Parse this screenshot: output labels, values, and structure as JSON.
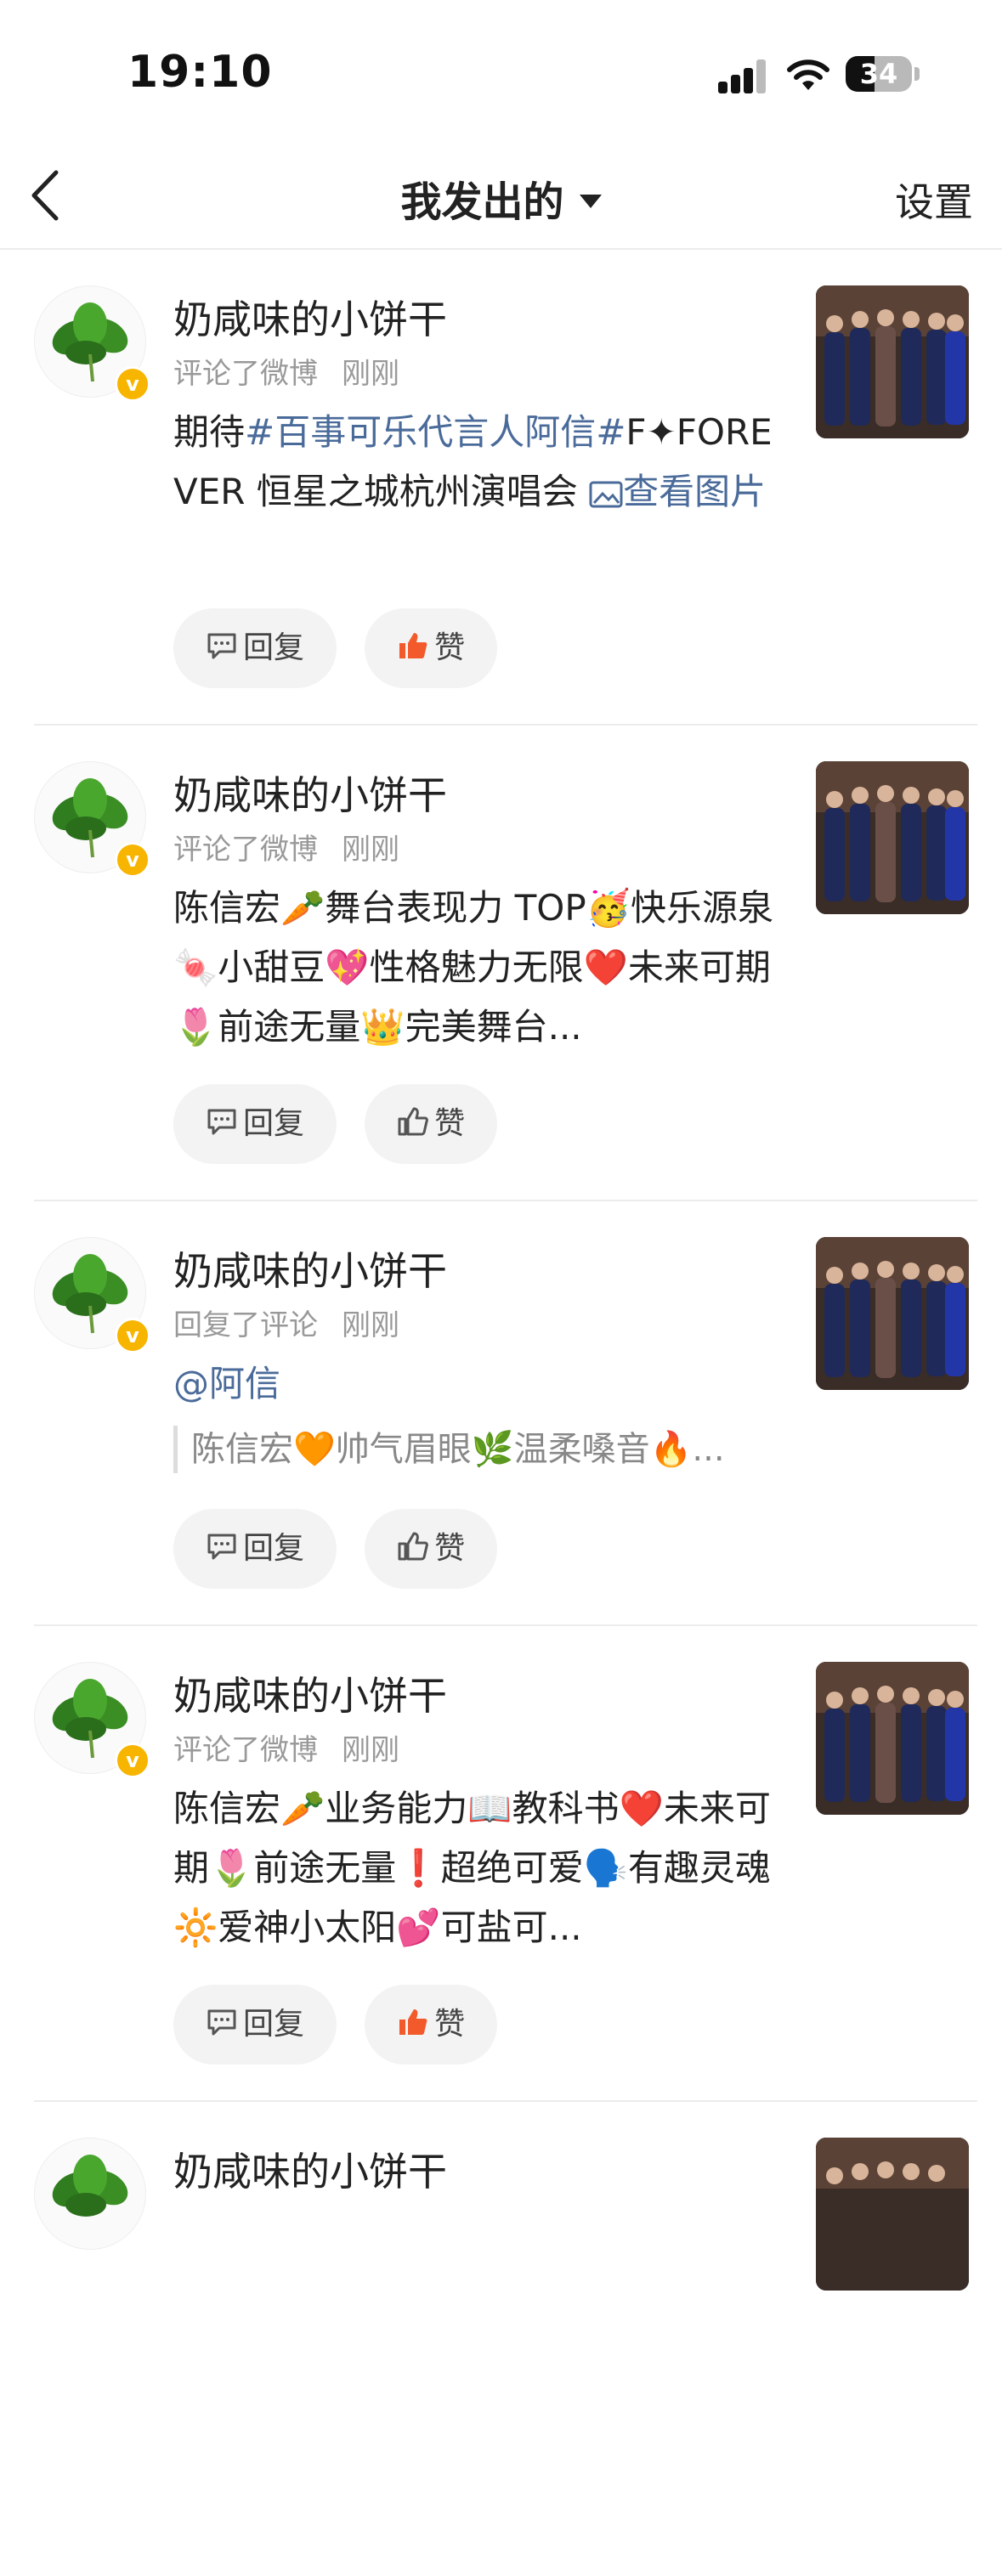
{
  "status_bar": {
    "time": "19:10",
    "battery": "34"
  },
  "nav": {
    "title": "我发出的",
    "settings": "设置"
  },
  "colors": {
    "accent_link": "#4a6b9a",
    "like_active": "#f25a2c",
    "badge": "#f7b500"
  },
  "items": [
    {
      "name": "奶咸味的小饼干",
      "action": "评论了微博",
      "time": "刚刚",
      "content_prefix": "期待",
      "hashtag": "#百事可乐代言人阿信#",
      "content_rest": "F✦FOREVER 恒星之城杭州演唱会 ",
      "view_pic": "查看图片",
      "reply": "回复",
      "like": "赞",
      "liked": true
    },
    {
      "name": "奶咸味的小饼干",
      "action": "评论了微博",
      "time": "刚刚",
      "content": "陈信宏🥕舞台表现力 TOP🥳快乐源泉🍬小甜豆💖性格魅力无限❤️未来可期🌷前途无量👑完美舞台...",
      "reply": "回复",
      "like": "赞",
      "liked": false
    },
    {
      "name": "奶咸味的小饼干",
      "action": "回复了评论",
      "time": "刚刚",
      "mention": "@阿信",
      "quote": "陈信宏🧡帅气眉眼🌿温柔嗓音🔥...",
      "reply": "回复",
      "like": "赞",
      "liked": false
    },
    {
      "name": "奶咸味的小饼干",
      "action": "评论了微博",
      "time": "刚刚",
      "content": "陈信宏🥕业务能力📖教科书❤️未来可期🌷前途无量❗超绝可爱🗣️有趣灵魂🔆爱神小太阳💕可盐可...",
      "reply": "回复",
      "like": "赞",
      "liked": true
    },
    {
      "name": "奶咸味的小饼干"
    }
  ]
}
